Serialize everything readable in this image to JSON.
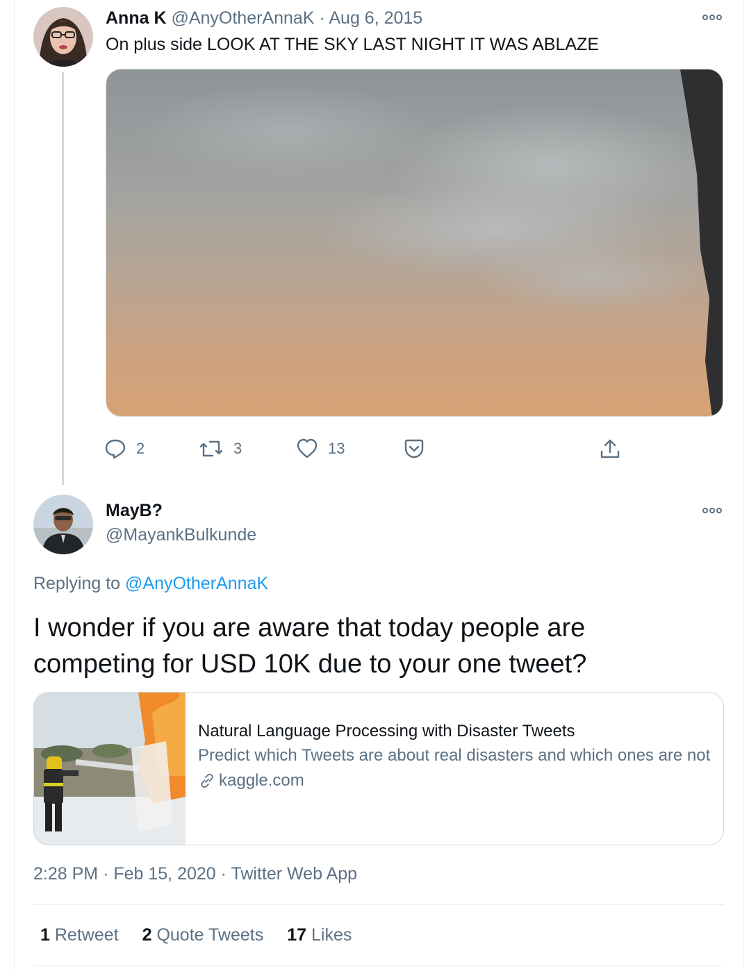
{
  "tweet1": {
    "display_name": "Anna K",
    "handle": "@AnyOtherAnnaK",
    "separator": "·",
    "date": "Aug 6, 2015",
    "text": "On plus side LOOK AT THE SKY LAST NIGHT IT WAS ABLAZE",
    "actions": {
      "replies": "2",
      "retweets": "3",
      "likes": "13"
    }
  },
  "tweet2": {
    "display_name": "MayB?",
    "handle": "@MayankBulkunde",
    "replying_prefix": "Replying to",
    "replying_to": "@AnyOtherAnnaK",
    "text": "I wonder if you are aware that today people are competing for USD 10K due to your one tweet?",
    "card": {
      "title": "Natural Language Processing with Disaster Tweets",
      "description": "Predict which Tweets are about real disasters and which ones are not",
      "domain": "kaggle.com"
    },
    "meta": {
      "time": "2:28 PM",
      "separator": "·",
      "date": "Feb 15, 2020",
      "source": "Twitter Web App"
    },
    "stats": {
      "retweets_count": "1",
      "retweets_label": "Retweet",
      "quotes_count": "2",
      "quotes_label": "Quote Tweets",
      "likes_count": "17",
      "likes_label": "Likes"
    }
  },
  "colors": {
    "accent": "#1d9bf0",
    "muted": "#5b7083",
    "text": "#0f1419",
    "border": "#cfd9de"
  },
  "icons": [
    "more-icon",
    "reply-icon",
    "retweet-icon",
    "like-icon",
    "bookmark-icon",
    "share-icon",
    "link-icon"
  ]
}
